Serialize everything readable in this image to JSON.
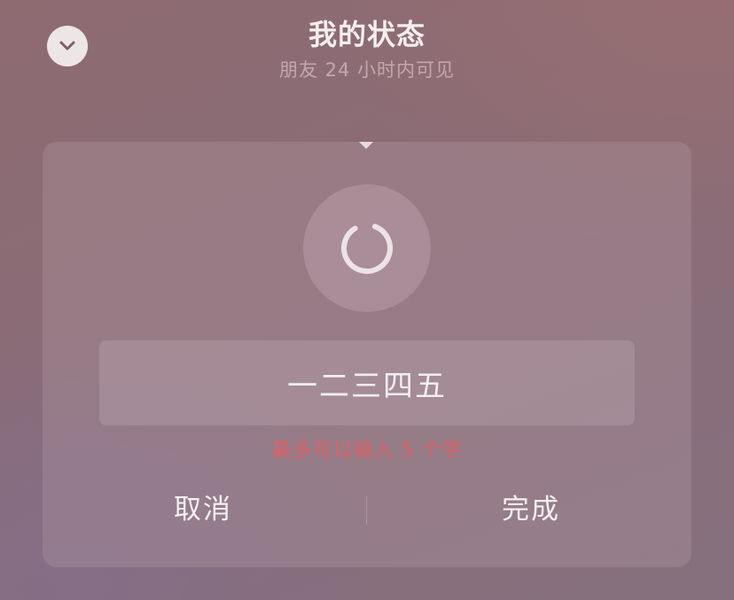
{
  "header": {
    "title": "我的状态",
    "subtitle": "朋友 24 小时内可见",
    "collapse_icon": "chevron-down-icon"
  },
  "status_card": {
    "emoji_icon": "loading-spinner-icon",
    "dropdown_icon": "caret-down-icon",
    "input_value": "一二三四五",
    "limit_hint": "最多可以输入 5 个字",
    "cancel_label": "取消",
    "done_label": "完成"
  },
  "colors": {
    "hint": "#e05f64",
    "text": "#f5f0f2"
  }
}
